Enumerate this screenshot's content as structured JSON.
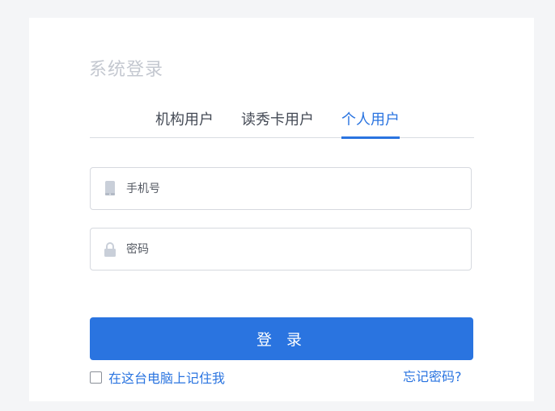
{
  "login": {
    "title": "系统登录",
    "tabs": [
      {
        "label": "机构用户"
      },
      {
        "label": "读秀卡用户"
      },
      {
        "label": "个人用户"
      }
    ],
    "phone_placeholder": "手机号",
    "password_placeholder": "密码",
    "submit_label": "登 录",
    "remember_label": "在这台电脑上记住我",
    "forgot_label": "忘记密码?"
  },
  "colors": {
    "accent": "#2a74e0",
    "title": "#c4c8d0",
    "border": "#d6d9df"
  },
  "icons": {
    "phone": "phone-icon",
    "password": "lock-icon"
  }
}
